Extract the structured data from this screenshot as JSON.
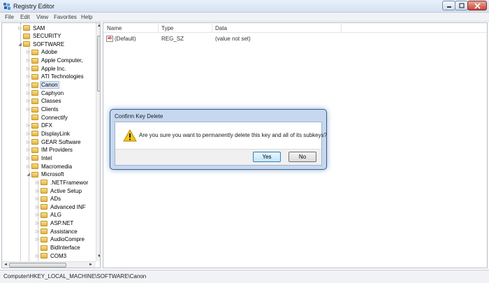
{
  "window": {
    "title": "Registry Editor"
  },
  "menu": [
    "File",
    "Edit",
    "View",
    "Favorites",
    "Help"
  ],
  "tree": [
    {
      "label": "SAM",
      "level": 2,
      "expander": "collapsed"
    },
    {
      "label": "SECURITY",
      "level": 2,
      "expander": "none"
    },
    {
      "label": "SOFTWARE",
      "level": 2,
      "expander": "expanded"
    },
    {
      "label": "Adobe",
      "level": 3,
      "expander": "collapsed"
    },
    {
      "label": "Apple Computer,",
      "level": 3,
      "expander": "collapsed"
    },
    {
      "label": "Apple Inc.",
      "level": 3,
      "expander": "collapsed"
    },
    {
      "label": "ATI Technologies",
      "level": 3,
      "expander": "collapsed"
    },
    {
      "label": "Canon",
      "level": 3,
      "expander": "collapsed",
      "selected": true
    },
    {
      "label": "Caphyon",
      "level": 3,
      "expander": "collapsed"
    },
    {
      "label": "Classes",
      "level": 3,
      "expander": "collapsed"
    },
    {
      "label": "Clients",
      "level": 3,
      "expander": "collapsed"
    },
    {
      "label": "Connectify",
      "level": 3,
      "expander": "none"
    },
    {
      "label": "DFX",
      "level": 3,
      "expander": "collapsed"
    },
    {
      "label": "DisplayLink",
      "level": 3,
      "expander": "collapsed"
    },
    {
      "label": "GEAR Software",
      "level": 3,
      "expander": "collapsed"
    },
    {
      "label": "IM Providers",
      "level": 3,
      "expander": "collapsed"
    },
    {
      "label": "Intel",
      "level": 3,
      "expander": "collapsed"
    },
    {
      "label": "Macromedia",
      "level": 3,
      "expander": "collapsed"
    },
    {
      "label": "Microsoft",
      "level": 3,
      "expander": "expanded"
    },
    {
      "label": ".NETFramewor",
      "level": 4,
      "expander": "collapsed"
    },
    {
      "label": "Active Setup",
      "level": 4,
      "expander": "collapsed"
    },
    {
      "label": "ADs",
      "level": 4,
      "expander": "collapsed"
    },
    {
      "label": "Advanced INF",
      "level": 4,
      "expander": "collapsed"
    },
    {
      "label": "ALG",
      "level": 4,
      "expander": "collapsed"
    },
    {
      "label": "ASP.NET",
      "level": 4,
      "expander": "collapsed"
    },
    {
      "label": "Assistance",
      "level": 4,
      "expander": "collapsed"
    },
    {
      "label": "AudioCompre",
      "level": 4,
      "expander": "collapsed"
    },
    {
      "label": "BidInterface",
      "level": 4,
      "expander": "none"
    },
    {
      "label": "COM3",
      "level": 4,
      "expander": "collapsed"
    }
  ],
  "columns": {
    "name": "Name",
    "type": "Type",
    "data": "Data"
  },
  "values": [
    {
      "name": "(Default)",
      "type": "REG_SZ",
      "data": "(value not set)",
      "icon": "string-value-icon"
    }
  ],
  "status": {
    "path": "Computer\\HKEY_LOCAL_MACHINE\\SOFTWARE\\Canon"
  },
  "dialog": {
    "title": "Confirm Key Delete",
    "message": "Are you sure you want to permanently delete this key and all of its subkeys?",
    "yes_label": "Yes",
    "no_label": "No",
    "icon": "warning-icon"
  },
  "colors": {
    "selection": "#dfe8f5",
    "dialog_frame": "#c6d8ef",
    "default_button": "#bee6fd"
  }
}
